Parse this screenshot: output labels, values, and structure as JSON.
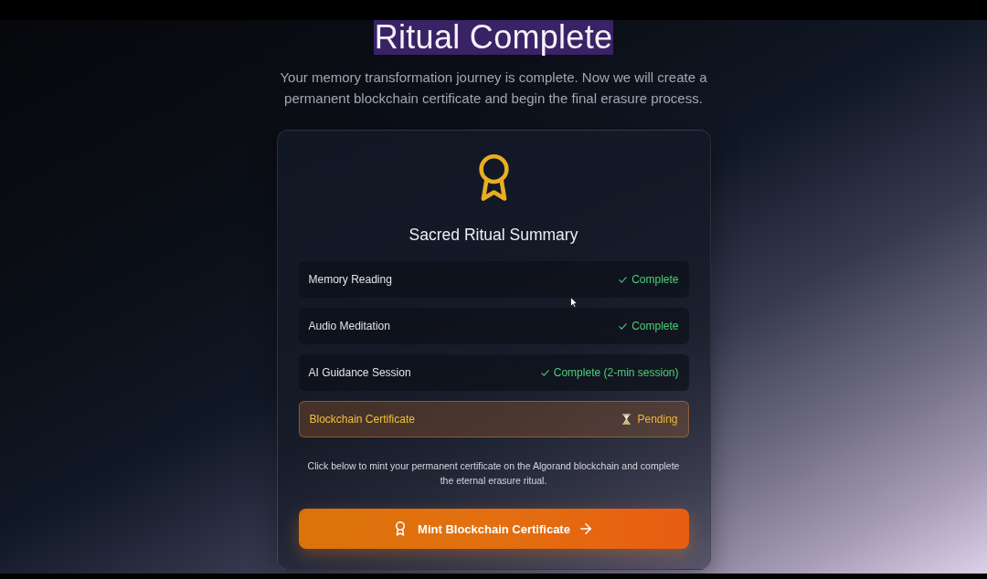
{
  "title": {
    "text": "Ritual Complete",
    "highlighted": true
  },
  "subtitle": "Your memory transformation journey is complete. Now we will create a permanent blockchain certificate and begin the final erasure process.",
  "summary": {
    "heading": "Sacred Ritual Summary",
    "items": [
      {
        "label": "Memory Reading",
        "status": "Complete",
        "kind": "complete"
      },
      {
        "label": "Audio Meditation",
        "status": "Complete",
        "kind": "complete"
      },
      {
        "label": "AI Guidance Session",
        "status": "Complete (2-min session)",
        "kind": "complete"
      },
      {
        "label": "Blockchain Certificate",
        "status": "Pending",
        "kind": "pending"
      }
    ],
    "note": "Click below to mint your permanent certificate on the Algorand blockchain and complete the eternal erasure ritual.",
    "action": {
      "label": "Mint Blockchain Certificate"
    }
  }
}
